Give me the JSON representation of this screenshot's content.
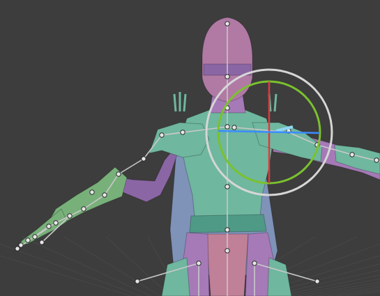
{
  "viewport": {
    "background": "#3d3d3d",
    "grid_color": "#474747"
  },
  "colors": {
    "armor_teal": "#6fb79f",
    "armor_teal_dark": "#4f9a86",
    "armor_green": "#78b07a",
    "cloth_purple": "#a57ab7",
    "cloth_purple_dark": "#8b66a4",
    "helmet_pink": "#b07aa5",
    "skirt_pink": "#c08098",
    "cape_blue": "#7f92b8",
    "bone_line": "#c8c8c8",
    "bone_joint": "#e6e6e6",
    "gizmo_view_ring": "#d6d6d6",
    "gizmo_x_axis": "#e0393e",
    "gizmo_y_axis": "#7bc12e",
    "gizmo_z_axis": "#3b8cff",
    "selected_bone": "#8fd6f0"
  },
  "rotate_gizmo": {
    "axes": [
      "X",
      "Y",
      "Z"
    ],
    "active_axis": "X"
  },
  "armature": {
    "icon": "bone-icon"
  }
}
